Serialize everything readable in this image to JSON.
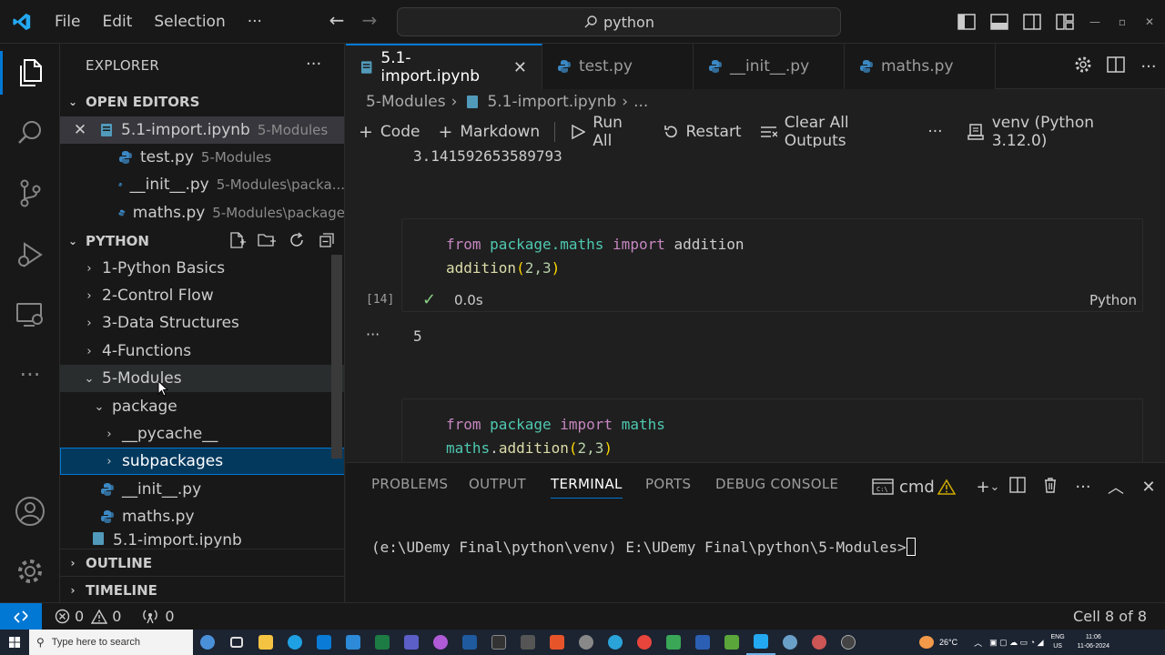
{
  "titlebar": {
    "menu": [
      "File",
      "Edit",
      "Selection",
      "···"
    ],
    "search": "python"
  },
  "explorer": {
    "title": "EXPLORER",
    "more": "···",
    "open_editors_title": "OPEN EDITORS",
    "open_editors": [
      {
        "name": "5.1-import.ipynb",
        "desc": "5-Modules",
        "type": "notebook"
      },
      {
        "name": "test.py",
        "desc": "5-Modules",
        "type": "python"
      },
      {
        "name": "__init__.py",
        "desc": "5-Modules\\packa...",
        "type": "python"
      },
      {
        "name": "maths.py",
        "desc": "5-Modules\\package",
        "type": "python"
      }
    ],
    "folder_title": "PYTHON",
    "tree": [
      {
        "label": "1-Python Basics"
      },
      {
        "label": "2-Control Flow"
      },
      {
        "label": "3-Data Structures"
      },
      {
        "label": "4-Functions"
      },
      {
        "label": "5-Modules"
      },
      {
        "label": "package"
      },
      {
        "label": "__pycache__"
      },
      {
        "label": "subpackages"
      },
      {
        "label": "__init__.py"
      },
      {
        "label": "maths.py"
      },
      {
        "label": "5.1-import.ipynb"
      }
    ],
    "outline_title": "OUTLINE",
    "timeline_title": "TIMELINE"
  },
  "tabs": [
    {
      "label": "5.1-import.ipynb",
      "close": "✕"
    },
    {
      "label": "test.py"
    },
    {
      "label": "__init__.py"
    },
    {
      "label": "maths.py"
    }
  ],
  "breadcrumb": {
    "folder": "5-Modules",
    "file": "5.1-import.ipynb",
    "rest": "...",
    "sep": "›"
  },
  "toolbar": {
    "code": "Code",
    "markdown": "Markdown",
    "run_all": "Run All",
    "restart": "Restart",
    "clear": "Clear All Outputs",
    "more": "···",
    "kernel": "venv (Python 3.12.0)"
  },
  "notebook": {
    "prev_output": "3.141592653589793",
    "cell1": {
      "exec_count": "[14]",
      "status_time": "0.0s",
      "language": "Python",
      "output": "5",
      "output_more": "···",
      "line1": {
        "kw1": "from",
        "mod": "package.maths",
        "kw2": "import",
        "name": "addition"
      },
      "line2": {
        "fn": "addition",
        "open": "(",
        "args": "2,3",
        "close": ")"
      }
    },
    "cell2": {
      "line1": {
        "kw1": "from",
        "mod": "package",
        "kw2": "import",
        "name": "maths"
      },
      "line2": {
        "obj": "maths",
        "dot": ".",
        "fn": "addition",
        "open": "(",
        "args": "2,3",
        "close": ")"
      }
    }
  },
  "panel": {
    "tabs": [
      "PROBLEMS",
      "OUTPUT",
      "TERMINAL",
      "PORTS",
      "DEBUG CONSOLE"
    ],
    "active_tab": "TERMINAL",
    "shell": "cmd",
    "terminal_line": "(e:\\UDemy Final\\python\\venv) E:\\UDemy Final\\python\\5-Modules>"
  },
  "statusbar": {
    "errors": "0",
    "warnings": "0",
    "ports": "0",
    "cell_position": "Cell 8 of 8"
  },
  "taskbar": {
    "search_placeholder": "Type here to search",
    "weather": "26°C",
    "lang_top": "ENG",
    "lang_bottom": "US",
    "time": "11:06",
    "date": "11-06-2024"
  },
  "colors": {
    "accent": "#0078d4",
    "selection": "#04395e",
    "keyword": "#c586c0",
    "module": "#4ec9b0",
    "function": "#dcdcaa",
    "success": "#89d185",
    "warning": "#cca700"
  }
}
